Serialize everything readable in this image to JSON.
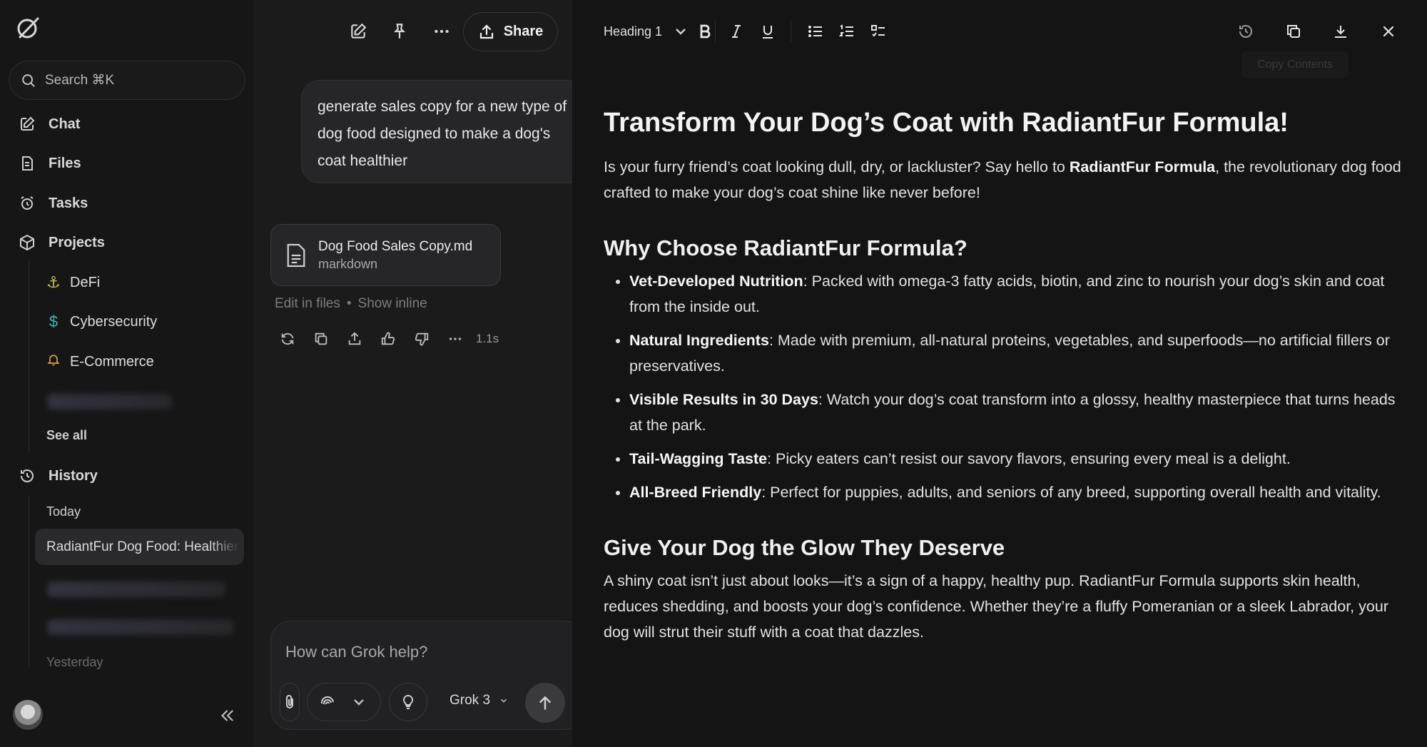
{
  "sidebar": {
    "search_label": "Search ⌘K",
    "nav": {
      "chat": "Chat",
      "files": "Files",
      "tasks": "Tasks",
      "projects": "Projects",
      "history": "History"
    },
    "projects": [
      {
        "label": "DeFi",
        "icon": "anchor-icon",
        "color": "#c9c24a"
      },
      {
        "label": "Cybersecurity",
        "icon": "dollar-icon",
        "color": "#3fb6a8"
      },
      {
        "label": "E-Commerce",
        "icon": "bell-icon",
        "color": "#d8a43a"
      }
    ],
    "see_all": "See all",
    "history_today": "Today",
    "history_active": "RadiantFur Dog Food: Healthier Coat",
    "history_yesterday": "Yesterday"
  },
  "chat": {
    "share_label": "Share",
    "user_message": "generate sales copy for a new type of dog food designed to make a dog's coat healthier",
    "file": {
      "name": "Dog Food Sales Copy.md",
      "type": "markdown"
    },
    "edit_in_files": "Edit in files",
    "dot": "•",
    "show_inline": "Show inline",
    "response_time": "1.1s",
    "composer_placeholder": "How can Grok help?",
    "model": "Grok 3"
  },
  "editor": {
    "heading_select": "Heading 1",
    "tooltip": "Copy Contents",
    "title": "Transform Your Dog’s Coat with RadiantFur Formula!",
    "intro_pre": "Is your furry friend’s coat looking dull, dry, or lackluster? Say hello to ",
    "intro_bold": "RadiantFur Formula",
    "intro_post": ", the revolutionary dog food crafted to make your dog’s coat shine like never before!",
    "section1_title": "Why Choose RadiantFur Formula?",
    "bullets": [
      {
        "bold": "Vet-Developed Nutrition",
        "text": ": Packed with omega-3 fatty acids, biotin, and zinc to nourish your dog’s skin and coat from the inside out."
      },
      {
        "bold": "Natural Ingredients",
        "text": ": Made with premium, all-natural proteins, vegetables, and superfoods—no artificial fillers or preservatives."
      },
      {
        "bold": "Visible Results in 30 Days",
        "text": ": Watch your dog’s coat transform into a glossy, healthy masterpiece that turns heads at the park."
      },
      {
        "bold": "Tail-Wagging Taste",
        "text": ": Picky eaters can’t resist our savory flavors, ensuring every meal is a delight."
      },
      {
        "bold": "All-Breed Friendly",
        "text": ": Perfect for puppies, adults, and seniors of any breed, supporting overall health and vitality."
      }
    ],
    "section2_title": "Give Your Dog the Glow They Deserve",
    "section2_body": "A shiny coat isn’t just about looks—it’s a sign of a happy, healthy pup. RadiantFur Formula supports skin health, reduces shedding, and boosts your dog’s confidence. Whether they’re a fluffy Pomeranian or a sleek Labrador, your dog will strut their stuff with a coat that dazzles."
  }
}
